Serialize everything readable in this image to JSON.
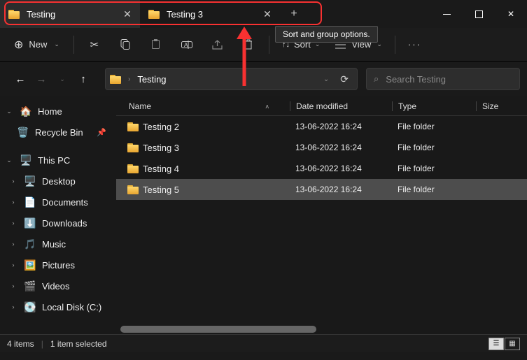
{
  "tabs": [
    {
      "label": "Testing",
      "active": true
    },
    {
      "label": "Testing 3",
      "active": false
    }
  ],
  "tooltip": "Sort and group options.",
  "toolbar": {
    "new": "New",
    "sort": "Sort",
    "view": "View"
  },
  "breadcrumb": {
    "folder": "Testing"
  },
  "search": {
    "placeholder": "Search Testing"
  },
  "sidebar": {
    "home": "Home",
    "recycle": "Recycle Bin",
    "thispc": "This PC",
    "items": [
      {
        "label": "Desktop"
      },
      {
        "label": "Documents"
      },
      {
        "label": "Downloads"
      },
      {
        "label": "Music"
      },
      {
        "label": "Pictures"
      },
      {
        "label": "Videos"
      },
      {
        "label": "Local Disk (C:)"
      }
    ]
  },
  "columns": {
    "name": "Name",
    "date": "Date modified",
    "type": "Type",
    "size": "Size"
  },
  "files": [
    {
      "name": "Testing 2",
      "date": "13-06-2022 16:24",
      "type": "File folder",
      "selected": false
    },
    {
      "name": "Testing 3",
      "date": "13-06-2022 16:24",
      "type": "File folder",
      "selected": false
    },
    {
      "name": "Testing 4",
      "date": "13-06-2022 16:24",
      "type": "File folder",
      "selected": false
    },
    {
      "name": "Testing 5",
      "date": "13-06-2022 16:24",
      "type": "File folder",
      "selected": true
    }
  ],
  "status": {
    "count": "4 items",
    "selected": "1 item selected"
  }
}
